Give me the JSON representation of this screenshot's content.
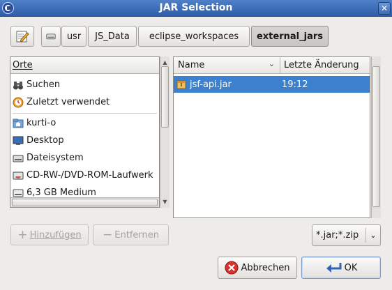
{
  "window": {
    "title": "JAR Selection"
  },
  "pathbar": {
    "segments": [
      "usr",
      "JS_Data",
      "eclipse_workspaces",
      "external_jars"
    ],
    "active_index": 3
  },
  "places": {
    "header": "Orte",
    "items": [
      {
        "label": "Suchen",
        "icon": "binoculars-icon"
      },
      {
        "label": "Zuletzt verwendet",
        "icon": "recent-icon"
      },
      {
        "label": "kurti-o",
        "icon": "home-folder-icon"
      },
      {
        "label": "Desktop",
        "icon": "desktop-icon"
      },
      {
        "label": "Dateisystem",
        "icon": "filesystem-icon"
      },
      {
        "label": "CD-RW-/DVD-ROM-Laufwerk",
        "icon": "optical-drive-icon"
      },
      {
        "label": "6,3 GB Medium",
        "icon": "drive-icon"
      }
    ],
    "add_label": "Hinzufügen",
    "remove_label": "Entfernen"
  },
  "files": {
    "col_name": "Name",
    "col_modified": "Letzte Änderung",
    "rows": [
      {
        "name": "jsf-api.jar",
        "modified": "19:12",
        "selected": true,
        "icon": "jar-archive-icon"
      }
    ]
  },
  "filter": {
    "value": "*.jar;*.zip"
  },
  "buttons": {
    "cancel": "Abbrechen",
    "ok": "OK"
  },
  "colors": {
    "title_bar": "#3b6bb8",
    "selection": "#3b81ce"
  }
}
